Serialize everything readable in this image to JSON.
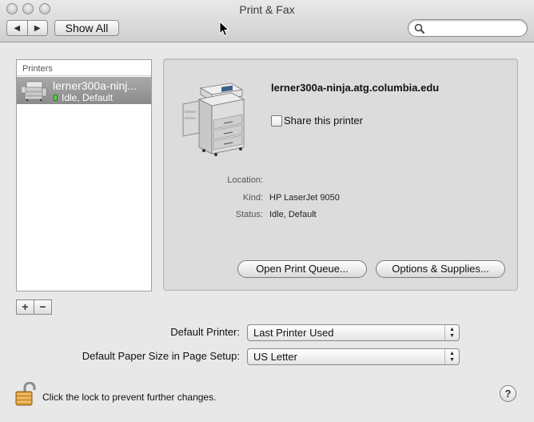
{
  "window": {
    "title": "Print & Fax"
  },
  "toolbar": {
    "back_glyph": "◀",
    "forward_glyph": "▶",
    "show_all_label": "Show All",
    "search_placeholder": ""
  },
  "printers": {
    "header": "Printers",
    "items": [
      {
        "name": "lerner300a-ninj...",
        "status": "Idle, Default",
        "status_color": "#5ed14c",
        "selected": true
      }
    ],
    "add_label": "+",
    "remove_label": "−"
  },
  "detail": {
    "printer_name": "lerner300a-ninja.atg.columbia.edu",
    "share_label": "Share this printer",
    "share_checked": false,
    "location_label": "Location:",
    "location_value": "",
    "kind_label": "Kind:",
    "kind_value": "HP LaserJet 9050",
    "status_label": "Status:",
    "status_value": "Idle, Default",
    "open_queue_label": "Open Print Queue...",
    "options_label": "Options & Supplies..."
  },
  "settings": {
    "default_printer_label": "Default Printer:",
    "default_printer_value": "Last Printer Used",
    "paper_size_label": "Default Paper Size in Page Setup:",
    "paper_size_value": "US Letter"
  },
  "footer": {
    "lock_text": "Click the lock to prevent further changes.",
    "help_label": "?"
  },
  "colors": {
    "selection": "#8b8b8b",
    "panel": "#dcdcdc",
    "window": "#e8e8e8"
  }
}
